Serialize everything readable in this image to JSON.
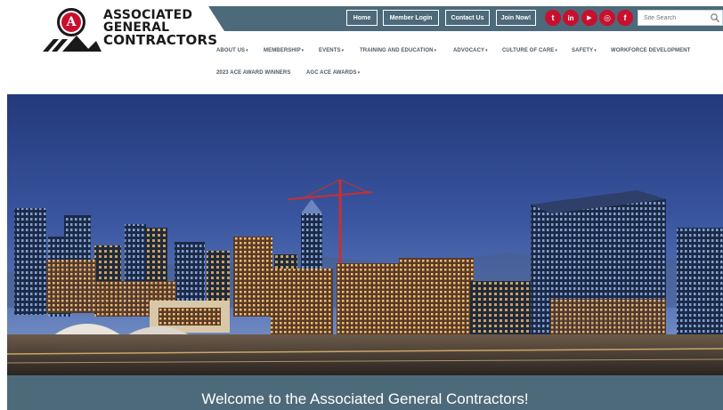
{
  "logo": {
    "line1": "ASSOCIATED",
    "line2": "GENERAL",
    "line3": "CONTRACTORS",
    "emblem_letter": "A"
  },
  "topbar": {
    "home": "Home",
    "member_login": "Member Login",
    "contact_us": "Contact Us",
    "join_now": "Join Now!",
    "social_icons": [
      "twitter-icon",
      "linkedin-icon",
      "youtube-icon",
      "instagram-icon",
      "facebook-icon"
    ],
    "social_glyphs": [
      "t",
      "in",
      "▶",
      "◎",
      "f"
    ]
  },
  "search": {
    "placeholder": "Site Search"
  },
  "nav": {
    "row1": [
      {
        "label": "ABOUT US",
        "dropdown": true
      },
      {
        "label": "MEMBERSHIP",
        "dropdown": true
      },
      {
        "label": "EVENTS",
        "dropdown": true
      },
      {
        "label": "TRAINING AND EDUCATION",
        "dropdown": true
      },
      {
        "label": "ADVOCACY",
        "dropdown": true
      },
      {
        "label": "CULTURE OF CARE",
        "dropdown": true
      },
      {
        "label": "SAFETY",
        "dropdown": true
      },
      {
        "label": "WORKFORCE DEVELOPMENT",
        "dropdown": false
      }
    ],
    "row2": [
      {
        "label": "2023 ACE AWARD WINNERS",
        "dropdown": false
      },
      {
        "label": "AGC ACE AWARDS",
        "dropdown": true
      }
    ],
    "caret": "▾"
  },
  "hero": {
    "welcome": "Welcome to the Associated General Contractors!"
  },
  "colors": {
    "brand_slate": "#4d6a7a",
    "brand_red": "#c8102e",
    "nav_text": "#4a5a66"
  }
}
